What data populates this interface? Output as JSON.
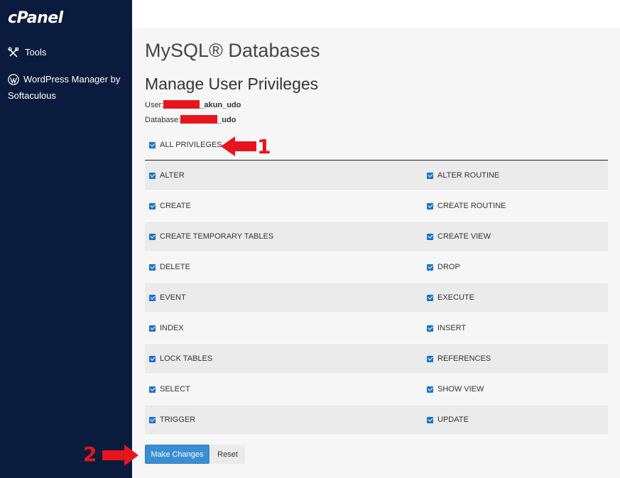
{
  "sidebar": {
    "logo": "cPanel",
    "items": [
      {
        "label": "Tools",
        "icon": "tools-icon"
      },
      {
        "label": "WordPress Manager by Softaculous",
        "icon": "wordpress-icon"
      }
    ]
  },
  "main": {
    "page_title": "MySQL® Databases",
    "section_title": "Manage User Privileges",
    "user_label": "User:",
    "user_suffix": "_akun_udo",
    "database_label": "Database:",
    "database_suffix": "_udo",
    "all_privileges": {
      "label": "ALL PRIVILEGES",
      "checked": true
    },
    "privileges": [
      {
        "left": "ALTER",
        "right": "ALTER ROUTINE"
      },
      {
        "left": "CREATE",
        "right": "CREATE ROUTINE"
      },
      {
        "left": "CREATE TEMPORARY TABLES",
        "right": "CREATE VIEW"
      },
      {
        "left": "DELETE",
        "right": "DROP"
      },
      {
        "left": "EVENT",
        "right": "EXECUTE"
      },
      {
        "left": "INDEX",
        "right": "INSERT"
      },
      {
        "left": "LOCK TABLES",
        "right": "REFERENCES"
      },
      {
        "left": "SELECT",
        "right": "SHOW VIEW"
      },
      {
        "left": "TRIGGER",
        "right": "UPDATE"
      }
    ],
    "make_changes_label": "Make Changes",
    "reset_label": "Reset"
  },
  "annotations": {
    "num1": "1",
    "num2": "2"
  },
  "colors": {
    "sidebar_bg": "#0b1b3d",
    "checkbox": "#1a73c8",
    "primary_button": "#3a8ed3",
    "annotation_red": "#e8141c"
  }
}
